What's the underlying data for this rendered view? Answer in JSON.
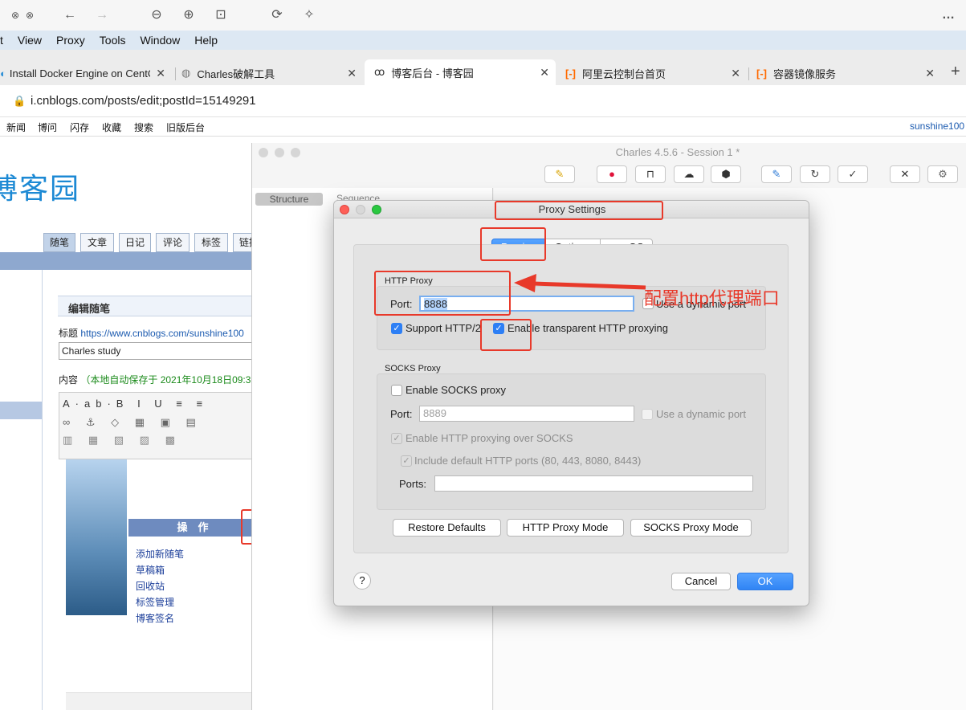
{
  "browser": {
    "menu": [
      "t",
      "View",
      "Proxy",
      "Tools",
      "Window",
      "Help"
    ],
    "tabs": [
      {
        "title": "Install Docker Engine on CentO",
        "icon": "docker-icon",
        "active": false
      },
      {
        "title": "Charles破解工具",
        "icon": "charles-icon",
        "active": false
      },
      {
        "title": "博客后台 - 博客园",
        "icon": "cnblogs-icon",
        "active": true
      },
      {
        "title": "阿里云控制台首页",
        "icon": "aliyun-icon",
        "active": false
      },
      {
        "title": "容器镜像服务",
        "icon": "aliyun-icon",
        "active": false
      }
    ],
    "url": "i.cnblogs.com/posts/edit;postId=15149291",
    "bookmarks": [
      "新闻",
      "博问",
      "闪存",
      "收藏",
      "搜索",
      "旧版后台"
    ],
    "user": "sunshine100",
    "more_label": "…",
    "new_tab_label": "+"
  },
  "cnblogs": {
    "logo": "博客园",
    "nav_tabs": [
      "随笔",
      "文章",
      "日记",
      "评论",
      "标签",
      "链接"
    ],
    "section_title": "编辑随笔",
    "title_label": "标题",
    "title_link": "https://www.cnblogs.com/sunshine100",
    "title_value": "Charles study",
    "content_label": "内容",
    "autosave": "（本地自动保存于 2021年10月18日09:3",
    "ops_header": "操　作",
    "ops_links": [
      "添加新随笔",
      "草稿箱",
      "回收站",
      "标签管理",
      "博客签名"
    ]
  },
  "charles": {
    "title": "Charles 4.5.6 - Session 1 *",
    "tabs": [
      "Structure",
      "Sequence"
    ]
  },
  "dialog": {
    "title": "Proxy Settings",
    "tabs": [
      {
        "label": "Proxies",
        "active": true
      },
      {
        "label": "Options",
        "active": false
      },
      {
        "label": "macOS",
        "active": false
      }
    ],
    "http": {
      "group_title": "HTTP Proxy",
      "port_label": "Port:",
      "port_value": "8888",
      "dynamic_port_label": "Use a dynamic port",
      "dynamic_port_checked": false,
      "http2_label": "Support HTTP/2",
      "http2_checked": true,
      "transparent_label": "Enable transparent HTTP proxying",
      "transparent_checked": true
    },
    "socks": {
      "group_title": "SOCKS Proxy",
      "enable_label": "Enable SOCKS proxy",
      "enable_checked": false,
      "port_label": "Port:",
      "port_value": "8889",
      "dynamic_port_label": "Use a dynamic port",
      "over_socks_label": "Enable HTTP proxying over SOCKS",
      "default_ports_label": "Include default HTTP ports (80, 443, 8080, 8443)",
      "ports_label": "Ports:",
      "ports_value": ""
    },
    "buttons": {
      "restore": "Restore Defaults",
      "http_mode": "HTTP Proxy Mode",
      "socks_mode": "SOCKS Proxy Mode",
      "help": "?",
      "cancel": "Cancel",
      "ok": "OK"
    }
  },
  "annotation": {
    "text": "配置http代理端口",
    "color": "#e8392a"
  },
  "colors": {
    "accent": "#2d7ff5",
    "annotation": "#e8392a",
    "cnblogs_blue": "#1c89d4",
    "autosave_green": "#1a8a1a"
  }
}
